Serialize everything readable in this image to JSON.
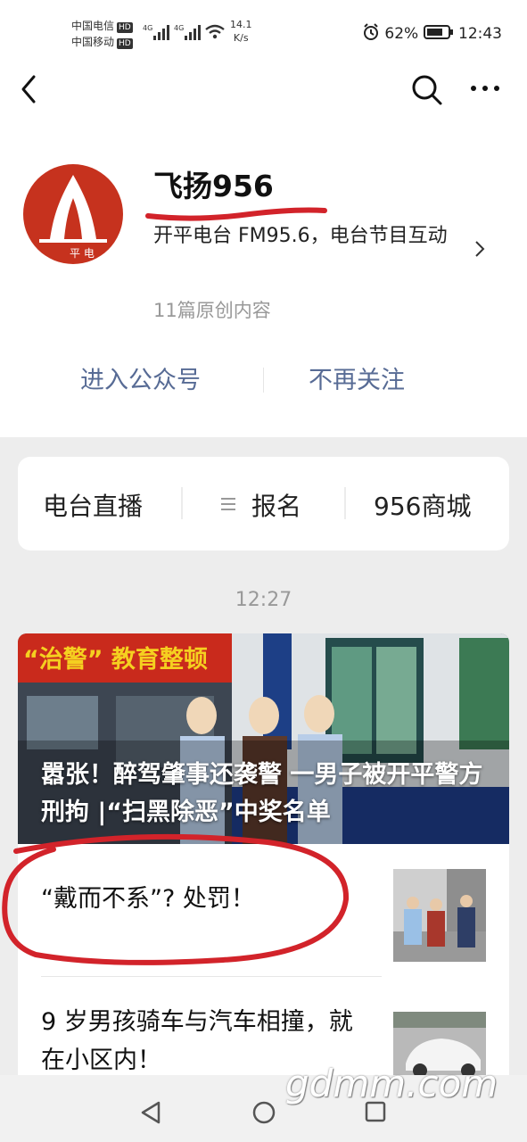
{
  "status": {
    "carrier1": "中国电信",
    "carrier2": "中国移动",
    "hd": "HD",
    "net_speed": "14.1",
    "net_unit": "K/s",
    "battery": "62%",
    "time": "12:43"
  },
  "icons": [
    "back-arrow-icon",
    "search-icon",
    "more-icon",
    "chevron-right-icon",
    "list-icon",
    "nav-back-icon",
    "nav-home-icon",
    "nav-recent-icon"
  ],
  "profile": {
    "name": "飞扬956",
    "description": "开平电台 FM95.6，电台节目互动",
    "original_count": "11篇原创内容",
    "enter_button": "进入公众号",
    "unfollow_button": "不再关注"
  },
  "menu": {
    "items": [
      "电台直播",
      "报名",
      "956商城"
    ]
  },
  "feed": {
    "time": "12:27",
    "hero_title": "嚣张！醉驾肇事还袭警 一男子被开平警方刑拘 |“扫黑除恶”中奖名单",
    "articles": [
      {
        "title": "“戴而不系”? 处罚！"
      },
      {
        "title": "9 岁男孩骑车与汽车相撞，就在小区内！"
      }
    ]
  },
  "watermark": "gdmm.com",
  "colors": {
    "link": "#576b95",
    "annotation_red": "#d2232a",
    "logo_red": "#c6321e"
  }
}
